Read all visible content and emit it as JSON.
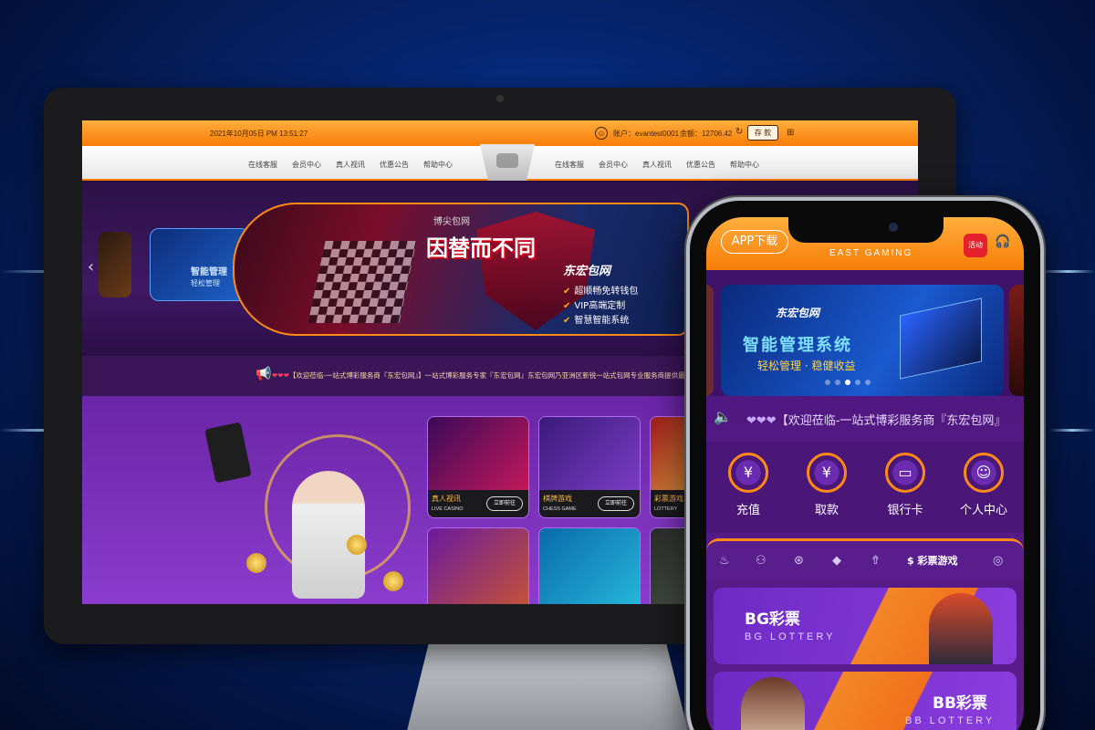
{
  "desktop": {
    "datetime": "2021年10月05日 PM 13:51:27",
    "account": "账户：evantest0001",
    "balance": "余额：12706.42",
    "deposit_label": "存 款",
    "nav_left": [
      "在线客服",
      "会员中心",
      "真人视讯",
      "优惠公告",
      "帮助中心"
    ],
    "nav_right": [
      "在线客服",
      "会员中心",
      "真人视讯",
      "优惠公告",
      "帮助中心"
    ],
    "banner": {
      "small_brand": "博尖包网",
      "slogan": "因替而不同",
      "brand_logo": "东宏包网",
      "side_title": "智能管理",
      "side_sub": "轻松管理",
      "features": [
        "超顺畅免转钱包",
        "VIP高端定制",
        "智慧智能系统"
      ]
    },
    "ticker": {
      "hearts": "❤❤❤",
      "text": "【欢迎莅临-一站式博彩服务商『东宏包网』】一站式博彩服务专家『东宏包网』东宏包网乃亚洲区新锐一站式包网专业服务商提供最先进、最稳"
    },
    "games": [
      {
        "cn": "真人视讯",
        "en": "LIVE CASINO",
        "go": "立即前往",
        "color": "#8a1b6b"
      },
      {
        "cn": "棋牌游戏",
        "en": "CHESS GAME",
        "go": "立即前往",
        "color": "#5b2a9e"
      },
      {
        "cn": "彩票游戏",
        "en": "LOTTERY",
        "go": "",
        "color": "#2a5a3a"
      }
    ]
  },
  "phone": {
    "app_download": "APP下载",
    "logo_text": "EAST GAMING",
    "promo": "活动",
    "banner": {
      "brand": "东宏包网",
      "headline": "智能管理系统",
      "sub": "轻松管理 · 稳健收益"
    },
    "ticker": {
      "hearts": "❤❤❤",
      "text": "【欢迎莅临-一站式博彩服务商『东宏包网』"
    },
    "quick_actions": [
      {
        "label": "充值",
        "icon": "¥"
      },
      {
        "label": "取款",
        "icon": "¥"
      },
      {
        "label": "银行卡",
        "icon": "▭"
      },
      {
        "label": "个人中心",
        "icon": "☺"
      }
    ],
    "tabs_icons": [
      "fire-icon",
      "people-icon",
      "chip-icon",
      "diamond-icon",
      "rocket-icon"
    ],
    "active_tab": "彩票游戏",
    "lottery_cards": [
      {
        "name": "BG彩票",
        "sub": "BG LOTTERY"
      },
      {
        "name": "BB彩票",
        "sub": "BB LOTTERY"
      }
    ]
  }
}
